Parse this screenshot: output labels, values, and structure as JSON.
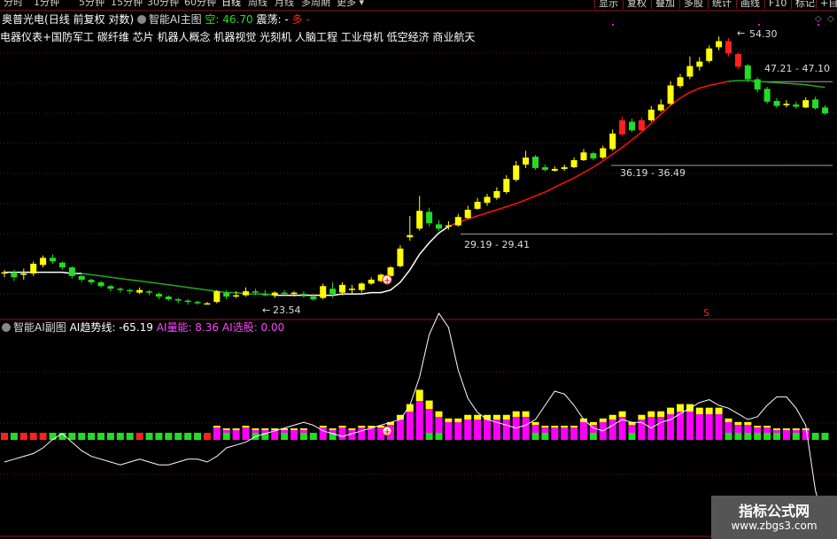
{
  "periods": [
    "分时",
    "1分钟",
    "5分钟",
    "15分钟",
    "30分钟",
    "60分钟",
    "日线",
    "周线",
    "月线",
    "多周期",
    "更多 ▾"
  ],
  "active_period": "日线",
  "right_buttons": [
    "显示",
    "复权",
    "叠加",
    "多股",
    "统计",
    "画线",
    "F10",
    "标记",
    "+自选"
  ],
  "main": {
    "stock_name": "奥普光电",
    "mode": "(日线 前复权 对数)",
    "indicator": "智能AI主图",
    "kong_label": "空: 46.70",
    "zhendang_label": "震荡: -",
    "duo_label": "多 -"
  },
  "concepts": "电器仪表+国防军工 碳纤维 芯片 机器人概念 机器视觉 光刻机 人脑工程 工业母机 低空经济 商业航天",
  "annotations": {
    "high": "54.30",
    "low": "23.54",
    "range1": "29.19 - 29.41",
    "range2": "36.19 - 36.49",
    "range3": "47.21 - 47.10",
    "signal": "S"
  },
  "sub": {
    "indicator": "智能AI副图",
    "trend_label": "AI趋势线: -65.19",
    "energy_label": "AI量能: 8.36",
    "select_label": "AI选股: 0.00"
  },
  "watermark": {
    "line1": "指标公式网",
    "line2": "www.zbgs3.com"
  },
  "colors": {
    "up": "#ff2020",
    "down": "#22dd22",
    "yellow": "#ffff00",
    "magenta": "#ff00ff",
    "ma_red": "#ff1010",
    "ma_green": "#22aa22"
  },
  "chart_data": {
    "type": "candlestick",
    "y_scale": "log",
    "candles": [
      [
        25.9,
        26.0,
        26.2,
        25.6
      ],
      [
        26.0,
        25.6,
        26.2,
        25.3
      ],
      [
        25.8,
        25.9,
        26.3,
        25.4
      ],
      [
        25.9,
        26.7,
        26.9,
        25.7
      ],
      [
        26.6,
        27.2,
        27.4,
        26.4
      ],
      [
        27.2,
        26.9,
        27.5,
        26.7
      ],
      [
        26.8,
        26.4,
        26.9,
        26.2
      ],
      [
        26.4,
        25.7,
        26.5,
        25.5
      ],
      [
        25.7,
        25.4,
        25.8,
        25.2
      ],
      [
        25.4,
        25.2,
        25.5,
        25.0
      ],
      [
        25.2,
        24.9,
        25.3,
        24.8
      ],
      [
        24.9,
        24.7,
        25.0,
        24.5
      ],
      [
        24.7,
        24.6,
        24.8,
        24.4
      ],
      [
        24.6,
        24.5,
        24.7,
        24.3
      ],
      [
        24.4,
        24.6,
        24.8,
        24.3
      ],
      [
        24.5,
        24.4,
        24.6,
        24.2
      ],
      [
        24.3,
        24.1,
        24.4,
        23.9
      ],
      [
        24.1,
        23.9,
        24.2,
        23.8
      ],
      [
        23.9,
        23.8,
        24.0,
        23.6
      ],
      [
        23.8,
        23.7,
        23.9,
        23.5
      ],
      [
        23.7,
        23.6,
        23.8,
        23.5
      ],
      [
        23.6,
        23.6,
        23.7,
        23.54
      ],
      [
        23.7,
        24.5,
        24.6,
        23.6
      ],
      [
        24.4,
        24.1,
        24.6,
        23.9
      ],
      [
        24.1,
        24.2,
        24.5,
        24.0
      ],
      [
        24.2,
        24.5,
        24.8,
        24.1
      ],
      [
        24.5,
        24.4,
        24.7,
        24.2
      ],
      [
        24.3,
        24.2,
        24.6,
        24.1
      ],
      [
        24.2,
        24.4,
        24.5,
        24.0
      ],
      [
        24.4,
        24.3,
        24.6,
        24.2
      ],
      [
        24.3,
        24.4,
        24.5,
        24.1
      ],
      [
        24.3,
        24.2,
        24.5,
        24.0
      ],
      [
        24.1,
        23.9,
        24.3,
        23.8
      ],
      [
        24.0,
        24.9,
        25.1,
        23.9
      ],
      [
        24.7,
        24.3,
        25.2,
        24.0
      ],
      [
        24.4,
        25.0,
        25.2,
        24.2
      ],
      [
        24.7,
        24.7,
        25.0,
        24.3
      ],
      [
        24.6,
        25.1,
        25.2,
        24.4
      ],
      [
        25.1,
        25.4,
        25.6,
        25.0
      ],
      [
        25.3,
        25.8,
        25.9,
        25.2
      ],
      [
        25.7,
        26.4,
        26.5,
        25.6
      ],
      [
        26.5,
        28.0,
        28.3,
        26.4
      ],
      [
        29.0,
        29.2,
        31.0,
        28.7
      ],
      [
        29.8,
        31.5,
        33.0,
        29.6
      ],
      [
        31.4,
        30.3,
        31.8,
        30.0
      ],
      [
        30.2,
        29.8,
        30.6,
        29.6
      ],
      [
        30.0,
        30.1,
        30.5,
        29.7
      ],
      [
        30.1,
        30.9,
        31.2,
        30.0
      ],
      [
        30.8,
        31.6,
        32.0,
        30.7
      ],
      [
        31.7,
        32.4,
        32.8,
        31.6
      ],
      [
        32.3,
        32.9,
        33.2,
        32.0
      ],
      [
        32.8,
        33.5,
        33.9,
        32.6
      ],
      [
        33.4,
        34.8,
        35.2,
        33.2
      ],
      [
        34.7,
        36.3,
        36.8,
        34.5
      ],
      [
        36.4,
        37.2,
        38.0,
        36.0
      ],
      [
        37.3,
        36.0,
        37.5,
        35.8
      ],
      [
        36.1,
        35.8,
        36.4,
        35.6
      ],
      [
        35.7,
        35.9,
        36.2,
        35.6
      ],
      [
        35.9,
        36.1,
        36.4,
        35.7
      ],
      [
        36.1,
        36.9,
        37.2,
        36.0
      ],
      [
        36.9,
        37.8,
        38.2,
        36.8
      ],
      [
        37.7,
        37.1,
        37.9,
        36.9
      ],
      [
        37.2,
        38.3,
        38.6,
        37.0
      ],
      [
        38.2,
        40.1,
        40.6,
        38.0
      ],
      [
        40.0,
        41.8,
        42.3,
        39.8
      ],
      [
        41.6,
        40.5,
        42.0,
        40.3
      ],
      [
        40.5,
        41.8,
        42.2,
        40.3
      ],
      [
        41.8,
        43.2,
        43.7,
        41.6
      ],
      [
        43.1,
        43.9,
        44.6,
        42.9
      ],
      [
        44.0,
        46.6,
        47.2,
        43.8
      ],
      [
        46.5,
        47.8,
        48.3,
        46.2
      ],
      [
        47.9,
        49.5,
        51.0,
        47.5
      ],
      [
        49.4,
        50.2,
        50.9,
        48.8
      ],
      [
        50.3,
        52.3,
        52.8,
        50.0
      ],
      [
        52.5,
        53.5,
        54.3,
        52.0
      ],
      [
        53.5,
        51.5,
        54.0,
        51.0
      ],
      [
        51.4,
        49.4,
        51.6,
        49.0
      ],
      [
        49.6,
        47.5,
        49.8,
        47.1
      ],
      [
        47.5,
        46.0,
        47.8,
        45.6
      ],
      [
        46.1,
        44.3,
        46.4,
        44.0
      ],
      [
        44.4,
        43.7,
        44.8,
        43.4
      ],
      [
        43.8,
        44.0,
        44.5,
        43.5
      ],
      [
        43.9,
        43.6,
        44.3,
        43.3
      ],
      [
        43.5,
        44.5,
        44.9,
        43.4
      ],
      [
        44.6,
        43.4,
        45.0,
        43.2
      ],
      [
        43.5,
        42.7,
        43.8,
        42.5
      ]
    ],
    "ma_line": [
      26.0,
      26.0,
      26.0,
      26.0,
      26.0,
      26.0,
      26.0,
      25.9,
      25.9,
      25.8,
      25.7,
      25.6,
      25.5,
      25.4,
      25.3,
      25.2,
      25.1,
      25.0,
      24.9,
      24.8,
      24.7,
      24.6,
      24.5,
      24.4,
      24.4,
      24.3,
      24.3,
      24.3,
      24.2,
      24.2,
      24.2,
      24.2,
      24.2,
      24.2,
      24.2,
      24.3,
      24.3,
      24.3,
      24.4,
      24.4,
      24.6,
      25.2,
      26.2,
      27.5,
      28.5,
      29.4,
      30.0,
      30.4,
      30.7,
      31.0,
      31.3,
      31.6,
      31.9,
      32.2,
      32.6,
      33.0,
      33.4,
      33.9,
      34.4,
      34.9,
      35.5,
      36.1,
      36.8,
      37.6,
      38.4,
      39.3,
      40.3,
      41.4,
      42.6,
      43.8,
      44.8,
      45.6,
      46.2,
      46.6,
      46.9,
      47.2,
      47.3,
      47.3,
      47.2,
      47.1,
      47.0,
      46.9,
      46.8,
      46.7,
      46.5,
      46.3
    ],
    "ma_color_split": 51,
    "sub_trend": [
      -20,
      -18,
      -16,
      -14,
      -10,
      -4,
      0,
      -6,
      -12,
      -16,
      -18,
      -20,
      -22,
      -20,
      -18,
      -20,
      -22,
      -22,
      -20,
      -18,
      -18,
      -20,
      -16,
      -10,
      -8,
      -6,
      -2,
      0,
      2,
      4,
      6,
      8,
      6,
      2,
      0,
      -2,
      0,
      2,
      4,
      6,
      8,
      10,
      20,
      40,
      70,
      85,
      75,
      45,
      25,
      15,
      10,
      8,
      6,
      4,
      6,
      10,
      20,
      30,
      28,
      20,
      10,
      4,
      2,
      6,
      10,
      8,
      8,
      4,
      8,
      10,
      14,
      18,
      22,
      24,
      20,
      18,
      14,
      10,
      12,
      20,
      26,
      26,
      18,
      6,
      -40,
      -65
    ],
    "sub_bars": [
      0,
      0,
      0,
      0,
      0,
      0,
      0,
      0,
      0,
      0,
      0,
      0,
      0,
      0,
      0,
      0,
      0,
      0,
      0,
      0,
      0,
      0,
      2,
      1,
      1,
      2,
      1,
      1,
      1,
      1,
      1,
      1,
      0,
      2,
      1,
      2,
      1,
      2,
      2,
      2,
      3,
      5,
      8,
      12,
      9,
      6,
      4,
      4,
      5,
      5,
      5,
      5,
      5,
      6,
      6,
      3,
      2,
      2,
      2,
      2,
      4,
      3,
      4,
      5,
      6,
      3,
      5,
      6,
      6,
      7,
      8,
      8,
      7,
      7,
      7,
      4,
      3,
      3,
      2,
      2,
      1,
      1,
      1,
      1,
      0,
      0
    ]
  }
}
